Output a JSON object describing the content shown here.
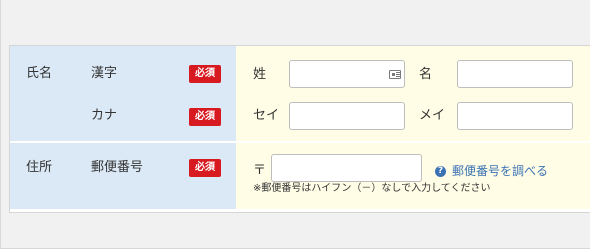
{
  "form": {
    "name": {
      "section_label": "氏名",
      "kanji_label": "漢字",
      "kana_label": "カナ",
      "required_badge": "必須",
      "last_name_label": "姓",
      "first_name_label": "名",
      "last_name_kana_label": "セイ",
      "first_name_kana_label": "メイ",
      "last_name_value": "",
      "first_name_value": "",
      "last_name_kana_value": "",
      "first_name_kana_value": ""
    },
    "address": {
      "section_label": "住所",
      "postal_label": "郵便番号",
      "required_badge": "必須",
      "postal_mark": "〒",
      "postal_value": "",
      "lookup_link": "郵便番号を調べる",
      "note": "※郵便番号はハイフン（－）なしで入力してください",
      "help_icon_text": "?"
    }
  },
  "colors": {
    "label_bg": "#dbe8f6",
    "input_bg": "#fffde6",
    "required_badge": "#d71920",
    "link": "#3b72b4"
  }
}
